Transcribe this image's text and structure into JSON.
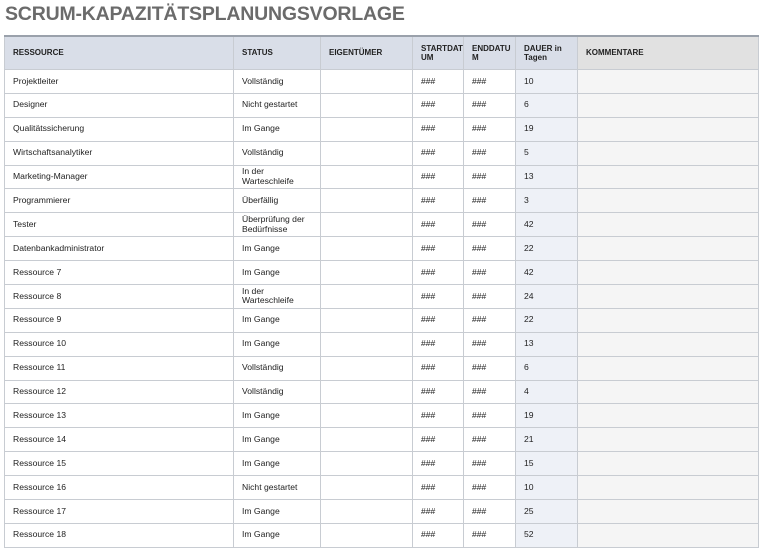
{
  "title": "SCRUM-KAPAZITÄTSPLANUNGSVORLAGE",
  "columns": {
    "resource": "RESSOURCE",
    "status": "STATUS",
    "owner": "EIGENTÜMER",
    "start": "STARTDAT UM",
    "end": "ENDDATU M",
    "duration": "DAUER in Tagen",
    "comments": "KOMMENTARE"
  },
  "rows": [
    {
      "resource": "Projektleiter",
      "status": "Vollständig",
      "owner": "",
      "start": "###",
      "end": "###",
      "duration": "10",
      "comments": ""
    },
    {
      "resource": "Designer",
      "status": "Nicht gestartet",
      "owner": "",
      "start": "###",
      "end": "###",
      "duration": "6",
      "comments": ""
    },
    {
      "resource": "Qualitätssicherung",
      "status": "Im Gange",
      "owner": "",
      "start": "###",
      "end": "###",
      "duration": "19",
      "comments": ""
    },
    {
      "resource": "Wirtschaftsanalytiker",
      "status": "Vollständig",
      "owner": "",
      "start": "###",
      "end": "###",
      "duration": "5",
      "comments": ""
    },
    {
      "resource": "Marketing-Manager",
      "status": "In der Warteschleife",
      "owner": "",
      "start": "###",
      "end": "###",
      "duration": "13",
      "comments": ""
    },
    {
      "resource": "Programmierer",
      "status": "Überfällig",
      "owner": "",
      "start": "###",
      "end": "###",
      "duration": "3",
      "comments": ""
    },
    {
      "resource": "Tester",
      "status": "Überprüfung der Bedürfnisse",
      "owner": "",
      "start": "###",
      "end": "###",
      "duration": "42",
      "comments": ""
    },
    {
      "resource": "Datenbankadministrator",
      "status": "Im Gange",
      "owner": "",
      "start": "###",
      "end": "###",
      "duration": "22",
      "comments": ""
    },
    {
      "resource": "Ressource 7",
      "status": "Im Gange",
      "owner": "",
      "start": "###",
      "end": "###",
      "duration": "42",
      "comments": ""
    },
    {
      "resource": "Ressource 8",
      "status": "In der Warteschleife",
      "owner": "",
      "start": "###",
      "end": "###",
      "duration": "24",
      "comments": ""
    },
    {
      "resource": "Ressource 9",
      "status": "Im Gange",
      "owner": "",
      "start": "###",
      "end": "###",
      "duration": "22",
      "comments": ""
    },
    {
      "resource": "Ressource 10",
      "status": "Im Gange",
      "owner": "",
      "start": "###",
      "end": "###",
      "duration": "13",
      "comments": ""
    },
    {
      "resource": "Ressource 11",
      "status": "Vollständig",
      "owner": "",
      "start": "###",
      "end": "###",
      "duration": "6",
      "comments": ""
    },
    {
      "resource": "Ressource 12",
      "status": "Vollständig",
      "owner": "",
      "start": "###",
      "end": "###",
      "duration": "4",
      "comments": ""
    },
    {
      "resource": "Ressource 13",
      "status": "Im Gange",
      "owner": "",
      "start": "###",
      "end": "###",
      "duration": "19",
      "comments": ""
    },
    {
      "resource": "Ressource 14",
      "status": "Im Gange",
      "owner": "",
      "start": "###",
      "end": "###",
      "duration": "21",
      "comments": ""
    },
    {
      "resource": "Ressource 15",
      "status": "Im Gange",
      "owner": "",
      "start": "###",
      "end": "###",
      "duration": "15",
      "comments": ""
    },
    {
      "resource": "Ressource 16",
      "status": "Nicht gestartet",
      "owner": "",
      "start": "###",
      "end": "###",
      "duration": "10",
      "comments": ""
    },
    {
      "resource": "Ressource 17",
      "status": "Im Gange",
      "owner": "",
      "start": "###",
      "end": "###",
      "duration": "25",
      "comments": ""
    },
    {
      "resource": "Ressource 18",
      "status": "Im Gange",
      "owner": "",
      "start": "###",
      "end": "###",
      "duration": "52",
      "comments": ""
    }
  ]
}
